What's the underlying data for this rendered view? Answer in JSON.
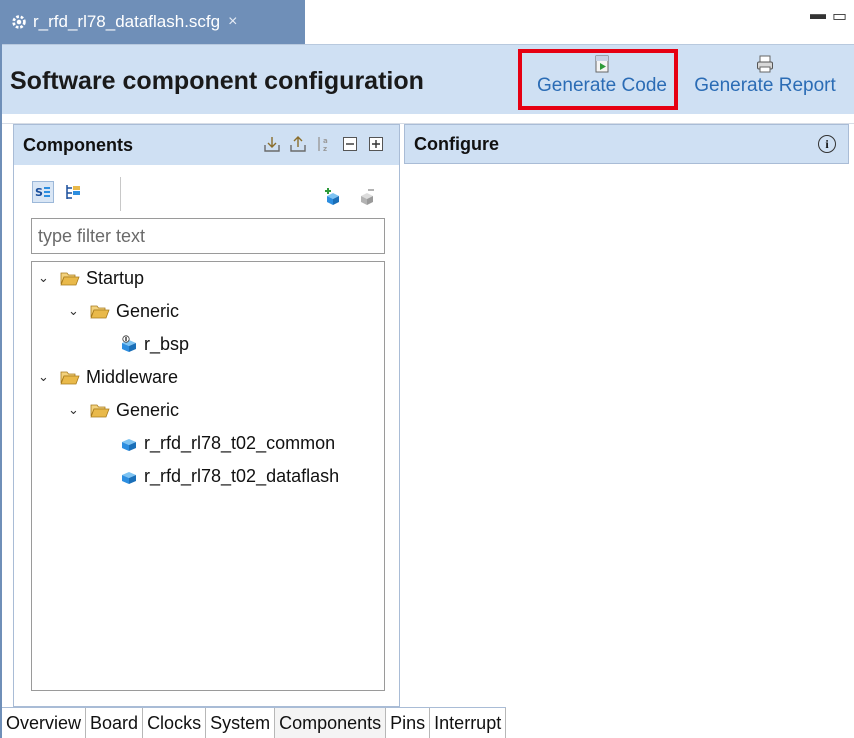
{
  "editor_tab": {
    "title": "r_rfd_rl78_dataflash.scfg",
    "close_glyph": "×"
  },
  "window_controls": {
    "minimize": "▬",
    "maximize": "▭"
  },
  "header": {
    "title": "Software component configuration",
    "generate_code": "Generate Code",
    "generate_report": "Generate Report"
  },
  "components_panel": {
    "title": "Components",
    "filter_placeholder": "type filter text",
    "tree": [
      {
        "label": "Startup",
        "type": "folder",
        "level": 0
      },
      {
        "label": "Generic",
        "type": "folder",
        "level": 1
      },
      {
        "label": "r_bsp",
        "type": "component",
        "level": 2
      },
      {
        "label": "Middleware",
        "type": "folder",
        "level": 0
      },
      {
        "label": "Generic",
        "type": "folder",
        "level": 1
      },
      {
        "label": "r_rfd_rl78_t02_common",
        "type": "component",
        "level": 2
      },
      {
        "label": "r_rfd_rl78_t02_dataflash",
        "type": "component",
        "level": 2
      }
    ]
  },
  "configure_panel": {
    "title": "Configure",
    "info_glyph": "i"
  },
  "bottom_tabs": [
    "Overview",
    "Board",
    "Clocks",
    "System",
    "Components",
    "Pins",
    "Interrupt"
  ],
  "icons": {
    "tab": "gear-icon",
    "generate_code": "generate-code-icon",
    "generate_report": "printer-icon",
    "folder_color": "#e9b94a",
    "cube_color": "#2d8ee0",
    "accent": "#2b6cb5",
    "highlight": "#e60012"
  }
}
